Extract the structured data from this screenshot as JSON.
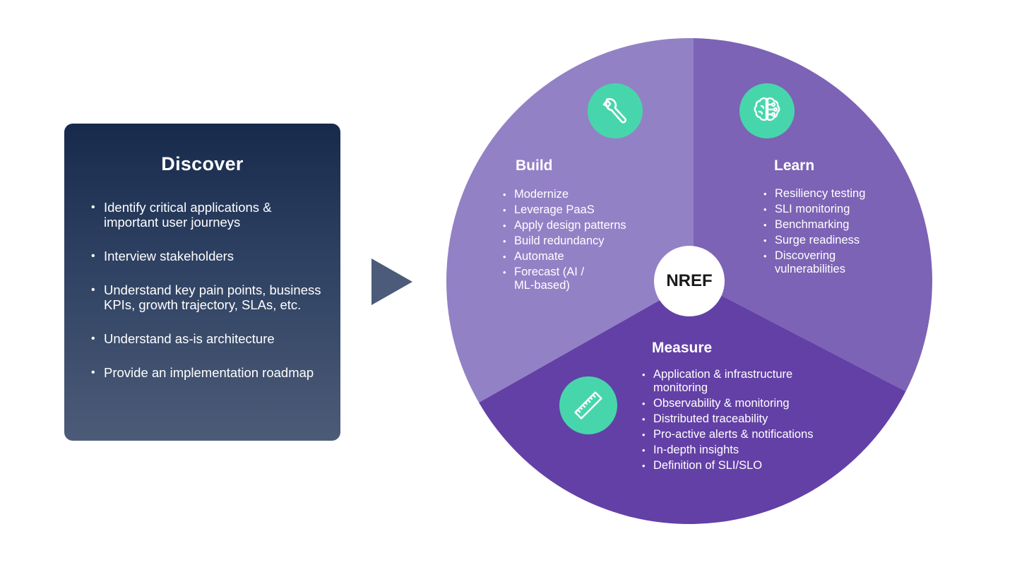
{
  "discover": {
    "title": "Discover",
    "items": [
      "Identify critical applications & important user journeys",
      "Interview stakeholders",
      "Understand key pain points, business KPIs, growth trajectory, SLAs, etc.",
      "Understand as-is architecture",
      "Provide an implementation roadmap"
    ]
  },
  "arrow_icon": "play-triangle-icon",
  "wheel": {
    "hub_label": "NREF",
    "colors": {
      "build": "#9381c6",
      "learn": "#7c63b5",
      "measure": "#6340a6",
      "icon_bg": "#47d6ab",
      "card_top": "#172a4c",
      "card_bottom": "#4c5b77",
      "arrow": "#4b5b79"
    },
    "segments": {
      "build": {
        "title": "Build",
        "icon": "wrench-icon",
        "items": [
          "Modernize",
          "Leverage PaaS",
          "Apply design patterns",
          "Build redundancy",
          "Automate",
          "Forecast (AI / ML-based)"
        ]
      },
      "learn": {
        "title": "Learn",
        "icon": "brain-circuit-icon",
        "items": [
          "Resiliency testing",
          "SLI monitoring",
          "Benchmarking",
          "Surge readiness",
          "Discovering vulnerabilities"
        ]
      },
      "measure": {
        "title": "Measure",
        "icon": "ruler-icon",
        "items": [
          "Application & infrastructure monitoring",
          "Observability & monitoring",
          "Distributed traceability",
          "Pro-active alerts & notifications",
          "In-depth insights",
          "Definition of SLI/SLO"
        ]
      }
    }
  }
}
